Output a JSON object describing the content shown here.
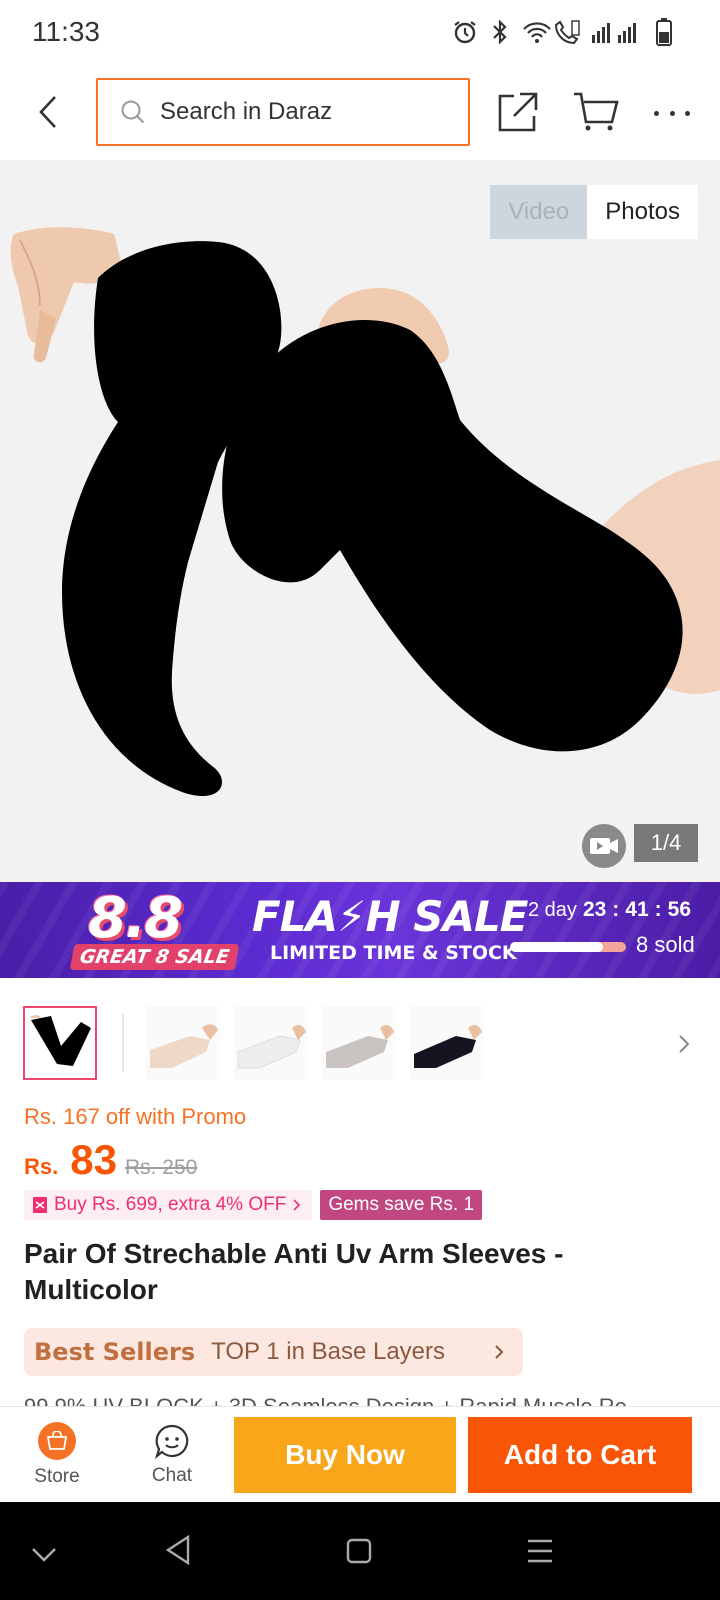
{
  "status_bar": {
    "time": "11:33"
  },
  "header": {
    "search_placeholder": "Search in Daraz"
  },
  "gallery": {
    "video_label": "Video",
    "photos_label": "Photos",
    "counter": "1/4"
  },
  "flash_sale": {
    "logo_number": "8.8",
    "logo_subtitle": "GREAT 8 SALE",
    "title": "FLA⚡H SALE",
    "subtitle": "LIMITED TIME & STOCK",
    "days": "2 day",
    "hours": "23",
    "minutes": "41",
    "seconds": "56",
    "sep": ":",
    "sold": "8 sold",
    "sold_fraction": 0.8
  },
  "thumbnails": [
    {
      "id": "thumb-1",
      "color": "#000000",
      "selected": true
    },
    {
      "id": "thumb-2",
      "color": "#efd9c6"
    },
    {
      "id": "thumb-3",
      "color": "#eeeeef"
    },
    {
      "id": "thumb-4",
      "color": "#c9c4c1"
    },
    {
      "id": "thumb-5",
      "color": "#151521"
    }
  ],
  "pricing": {
    "promo_off": "Rs. 167 off with Promo",
    "currency": "Rs.",
    "price": "83",
    "original_price": "Rs. 250",
    "voucher": "Buy Rs. 699, extra 4% OFF",
    "gems": "Gems save Rs. 1"
  },
  "product": {
    "title": "Pair Of Strechable Anti Uv Arm Sleeves - Multicolor"
  },
  "best_sellers": {
    "label": "Best Sellers",
    "rank": "TOP 1 in Base Layers"
  },
  "features_text": "99.9% UV BLOCK + 3D Seamless Design + Rapid Muscle Re",
  "action_bar": {
    "store_label": "Store",
    "chat_label": "Chat",
    "buy_now_label": "Buy Now",
    "add_to_cart_label": "Add to Cart"
  },
  "colors": {
    "accent": "#f57224",
    "buy_now": "#faa61a",
    "add_to_cart": "#f85606"
  }
}
